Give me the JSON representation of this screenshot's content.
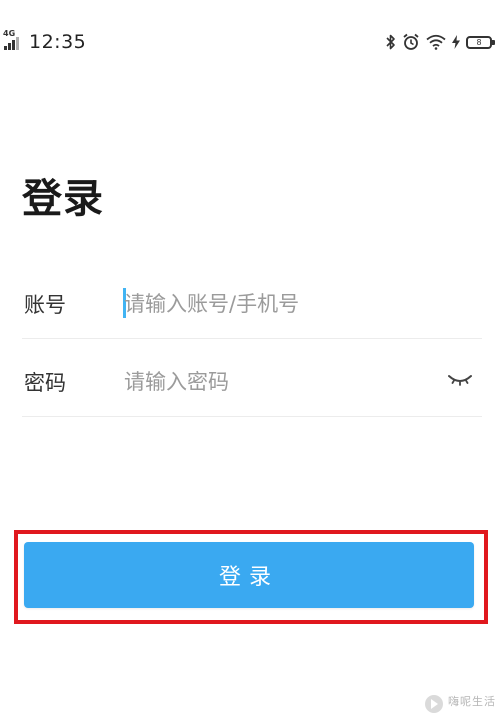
{
  "status_bar": {
    "network": "4G",
    "time": "12:35",
    "battery_level": "8",
    "icons": [
      "signal-icon",
      "bluetooth-icon",
      "alarm-icon",
      "wifi-icon",
      "charging-icon",
      "battery-icon"
    ]
  },
  "page": {
    "title": "登录"
  },
  "form": {
    "account": {
      "label": "账号",
      "placeholder": "请输入账号/手机号",
      "value": ""
    },
    "password": {
      "label": "密码",
      "placeholder": "请输入密码",
      "value": "",
      "toggle_icon": "eye-closed-icon"
    }
  },
  "actions": {
    "login_label": "登录"
  },
  "highlight": {
    "color": "#e0181e",
    "target": "login-button"
  },
  "colors": {
    "accent": "#3aa9f1",
    "caret": "#41b4f3",
    "highlight": "#e0181e"
  },
  "watermark": {
    "text": "嗨呢生活",
    "icon": "watermark-logo"
  }
}
